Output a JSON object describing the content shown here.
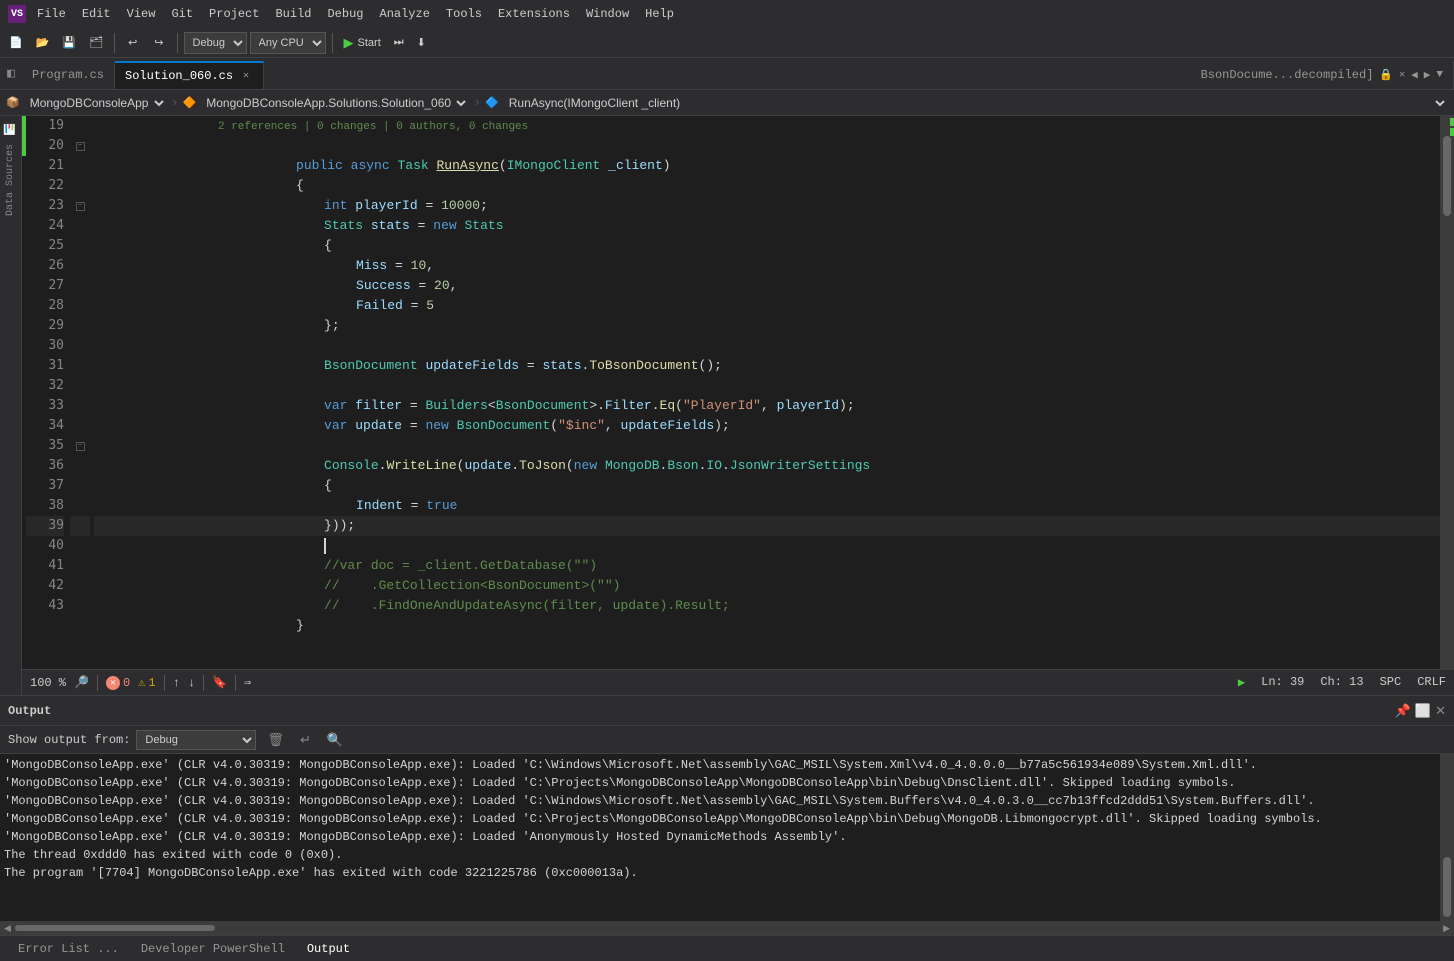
{
  "toolbar": {
    "debug_label": "Debug",
    "anycpu_label": "Any CPU",
    "start_label": "Start",
    "zoom_label": "100 %"
  },
  "tabs": [
    {
      "label": "Program.cs",
      "active": false,
      "closable": false
    },
    {
      "label": "Solution_060.cs",
      "active": true,
      "closable": true
    }
  ],
  "breadcrumb": {
    "project": "MongoDBConsoleApp",
    "namespace": "MongoDBConsoleApp.Solutions.Solution_060",
    "method": "RunAsync(IMongoClient _client)"
  },
  "decompiled_tab": "BsonDocume...decompiled]",
  "code": {
    "ref_text": "2 references | 0 changes | 0 authors, 0 changes",
    "lines": [
      {
        "num": 19,
        "content": "",
        "modified": true
      },
      {
        "num": 20,
        "content": "    public async Task RunAsync(IMongoClient _client)",
        "modified": true
      },
      {
        "num": 21,
        "content": "    {",
        "modified": false
      },
      {
        "num": 22,
        "content": "        int playerId = 10000;",
        "modified": false
      },
      {
        "num": 23,
        "content": "        Stats stats = new Stats",
        "modified": false
      },
      {
        "num": 24,
        "content": "        {",
        "modified": false
      },
      {
        "num": 25,
        "content": "            Miss = 10,",
        "modified": false
      },
      {
        "num": 26,
        "content": "            Success = 20,",
        "modified": false
      },
      {
        "num": 27,
        "content": "            Failed = 5",
        "modified": false
      },
      {
        "num": 28,
        "content": "        };",
        "modified": false
      },
      {
        "num": 29,
        "content": "",
        "modified": false
      },
      {
        "num": 30,
        "content": "        BsonDocument updateFields = stats.ToBsonDocument();",
        "modified": false
      },
      {
        "num": 31,
        "content": "",
        "modified": false
      },
      {
        "num": 32,
        "content": "        var filter = Builders<BsonDocument>.Filter.Eq(\"PlayerId\", playerId);",
        "modified": false
      },
      {
        "num": 33,
        "content": "        var update = new BsonDocument(\"$inc\", updateFields);",
        "modified": false
      },
      {
        "num": 34,
        "content": "",
        "modified": false
      },
      {
        "num": 35,
        "content": "        Console.WriteLine(update.ToJson(new MongoDB.Bson.IO.JsonWriterSettings",
        "modified": false
      },
      {
        "num": 36,
        "content": "        {",
        "modified": false
      },
      {
        "num": 37,
        "content": "            Indent = true",
        "modified": false
      },
      {
        "num": 38,
        "content": "        }));",
        "modified": false
      },
      {
        "num": 39,
        "content": "",
        "modified": false,
        "active": true
      },
      {
        "num": 40,
        "content": "        //var doc = _client.GetDatabase(\"\")",
        "modified": false
      },
      {
        "num": 41,
        "content": "        //    .GetCollection<BsonDocument>(\"\")",
        "modified": false
      },
      {
        "num": 42,
        "content": "        //    .FindOneAndUpdateAsync(filter, update).Result;",
        "modified": false
      },
      {
        "num": 43,
        "content": "    }",
        "modified": false
      }
    ]
  },
  "status": {
    "zoom": "100 %",
    "error_icon": "✕",
    "error_count": "0",
    "warning_icon": "⚠",
    "warning_count": "1",
    "ln": "Ln: 39",
    "ch": "Ch: 13",
    "encoding": "SPC",
    "line_ending": "CRLF"
  },
  "output_panel": {
    "title": "Output",
    "source_label": "Show output from:",
    "source_value": "Debug",
    "lines": [
      "'MongoDBConsoleApp.exe' (CLR v4.0.30319: MongoDBConsoleApp.exe): Loaded 'C:\\Windows\\Microsoft.Net\\assembly\\GAC_MSIL\\System.Xml\\v4.0_4.0.0.0__b77a5c561934e089\\System.Xml.dll'.",
      "'MongoDBConsoleApp.exe' (CLR v4.0.30319: MongoDBConsoleApp.exe): Loaded 'C:\\Projects\\MongoDBConsoleApp\\MongoDBConsoleApp\\bin\\Debug\\DnsClient.dll'. Skipped loading symbols.",
      "'MongoDBConsoleApp.exe' (CLR v4.0.30319: MongoDBConsoleApp.exe): Loaded 'C:\\Windows\\Microsoft.Net\\assembly\\GAC_MSIL\\System.Buffers\\v4.0_4.0.3.0__cc7b13ffcd2ddd51\\System.Buffers.dll'.",
      "'MongoDBConsoleApp.exe' (CLR v4.0.30319: MongoDBConsoleApp.exe): Loaded 'C:\\Projects\\MongoDBConsoleApp\\MongoDBConsoleApp\\bin\\Debug\\MongoDB.Libmongocrypt.dll'. Skipped loading symbols.",
      "'MongoDBConsoleApp.exe' (CLR v4.0.30319: MongoDBConsoleApp.exe): Loaded 'Anonymously Hosted DynamicMethods Assembly'.",
      "The thread 0xddd0 has exited with code 0 (0x0).",
      "The program '[7704] MongoDBConsoleApp.exe' has exited with code 3221225786 (0xc000013a)."
    ]
  },
  "bottom_tabs": [
    {
      "label": "Error List ...",
      "active": false
    },
    {
      "label": "Developer PowerShell",
      "active": false
    },
    {
      "label": "Output",
      "active": true
    }
  ],
  "menu": {
    "items": [
      "File",
      "Edit",
      "View",
      "Git",
      "Project",
      "Build",
      "Debug",
      "Analyze",
      "Tools",
      "Extensions",
      "Window",
      "Help"
    ]
  }
}
